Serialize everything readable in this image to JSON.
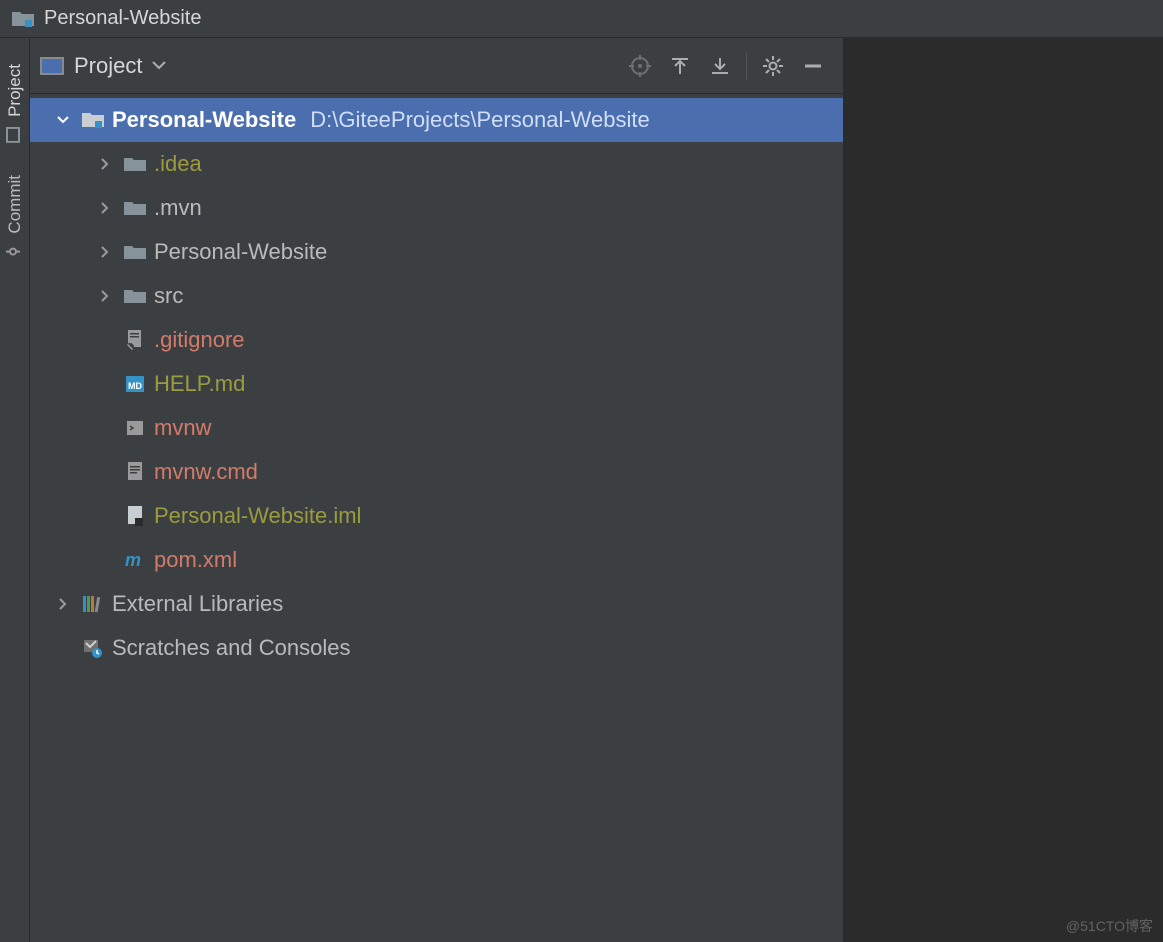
{
  "titlebar": {
    "project_name": "Personal-Website"
  },
  "sidebar": {
    "tabs": [
      {
        "id": "project",
        "label": "Project"
      },
      {
        "id": "commit",
        "label": "Commit"
      }
    ]
  },
  "panel": {
    "title": "Project",
    "toolbar": {
      "target": "Select Opened File",
      "expand": "Expand All",
      "collapse": "Collapse All",
      "settings": "Settings",
      "hide": "Hide"
    }
  },
  "tree": {
    "root": {
      "name": "Personal-Website",
      "path": "D:\\GiteeProjects\\Personal-Website"
    },
    "children": [
      {
        "name": ".idea",
        "type": "folder",
        "color": "olive",
        "expandable": true
      },
      {
        "name": ".mvn",
        "type": "folder",
        "color": "default",
        "expandable": true
      },
      {
        "name": "Personal-Website",
        "type": "folder",
        "color": "default",
        "expandable": true
      },
      {
        "name": "src",
        "type": "folder",
        "color": "default",
        "expandable": true
      },
      {
        "name": ".gitignore",
        "type": "file-git",
        "color": "red",
        "expandable": false
      },
      {
        "name": "HELP.md",
        "type": "file-md",
        "color": "olive",
        "expandable": false
      },
      {
        "name": "mvnw",
        "type": "file-sh",
        "color": "red",
        "expandable": false
      },
      {
        "name": "mvnw.cmd",
        "type": "file-txt",
        "color": "red",
        "expandable": false
      },
      {
        "name": "Personal-Website.iml",
        "type": "file-iml",
        "color": "olive",
        "expandable": false
      },
      {
        "name": "pom.xml",
        "type": "file-maven",
        "color": "red",
        "expandable": false
      }
    ],
    "external_libraries": "External Libraries",
    "scratches": "Scratches and Consoles"
  },
  "watermark": "@51CTO博客"
}
